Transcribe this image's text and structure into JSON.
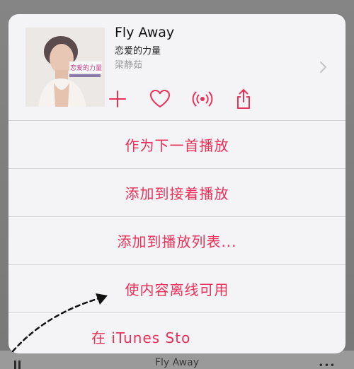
{
  "background": {
    "now_playing_label": "Fly Away"
  },
  "song": {
    "title": "Fly Away",
    "album": "恋爱的力量",
    "artist": "梁静茹",
    "cover_text": "恋爱的力量"
  },
  "actions": [
    {
      "icon": "plus-icon",
      "name": "add-button"
    },
    {
      "icon": "heart-icon",
      "name": "love-button"
    },
    {
      "icon": "radio-icon",
      "name": "create-station-button"
    },
    {
      "icon": "share-icon",
      "name": "share-button"
    }
  ],
  "menu": {
    "play_next": "作为下一首播放",
    "add_to_up_next": "添加到接着播放",
    "add_to_playlist": "添加到播放列表...",
    "make_available_offline": "使内容离线可用",
    "itunes_store": "在 iTunes Sto"
  },
  "colors": {
    "accent": "#e8325a",
    "sheet": "#f4f3f5",
    "separator": "#d4d3d6"
  }
}
